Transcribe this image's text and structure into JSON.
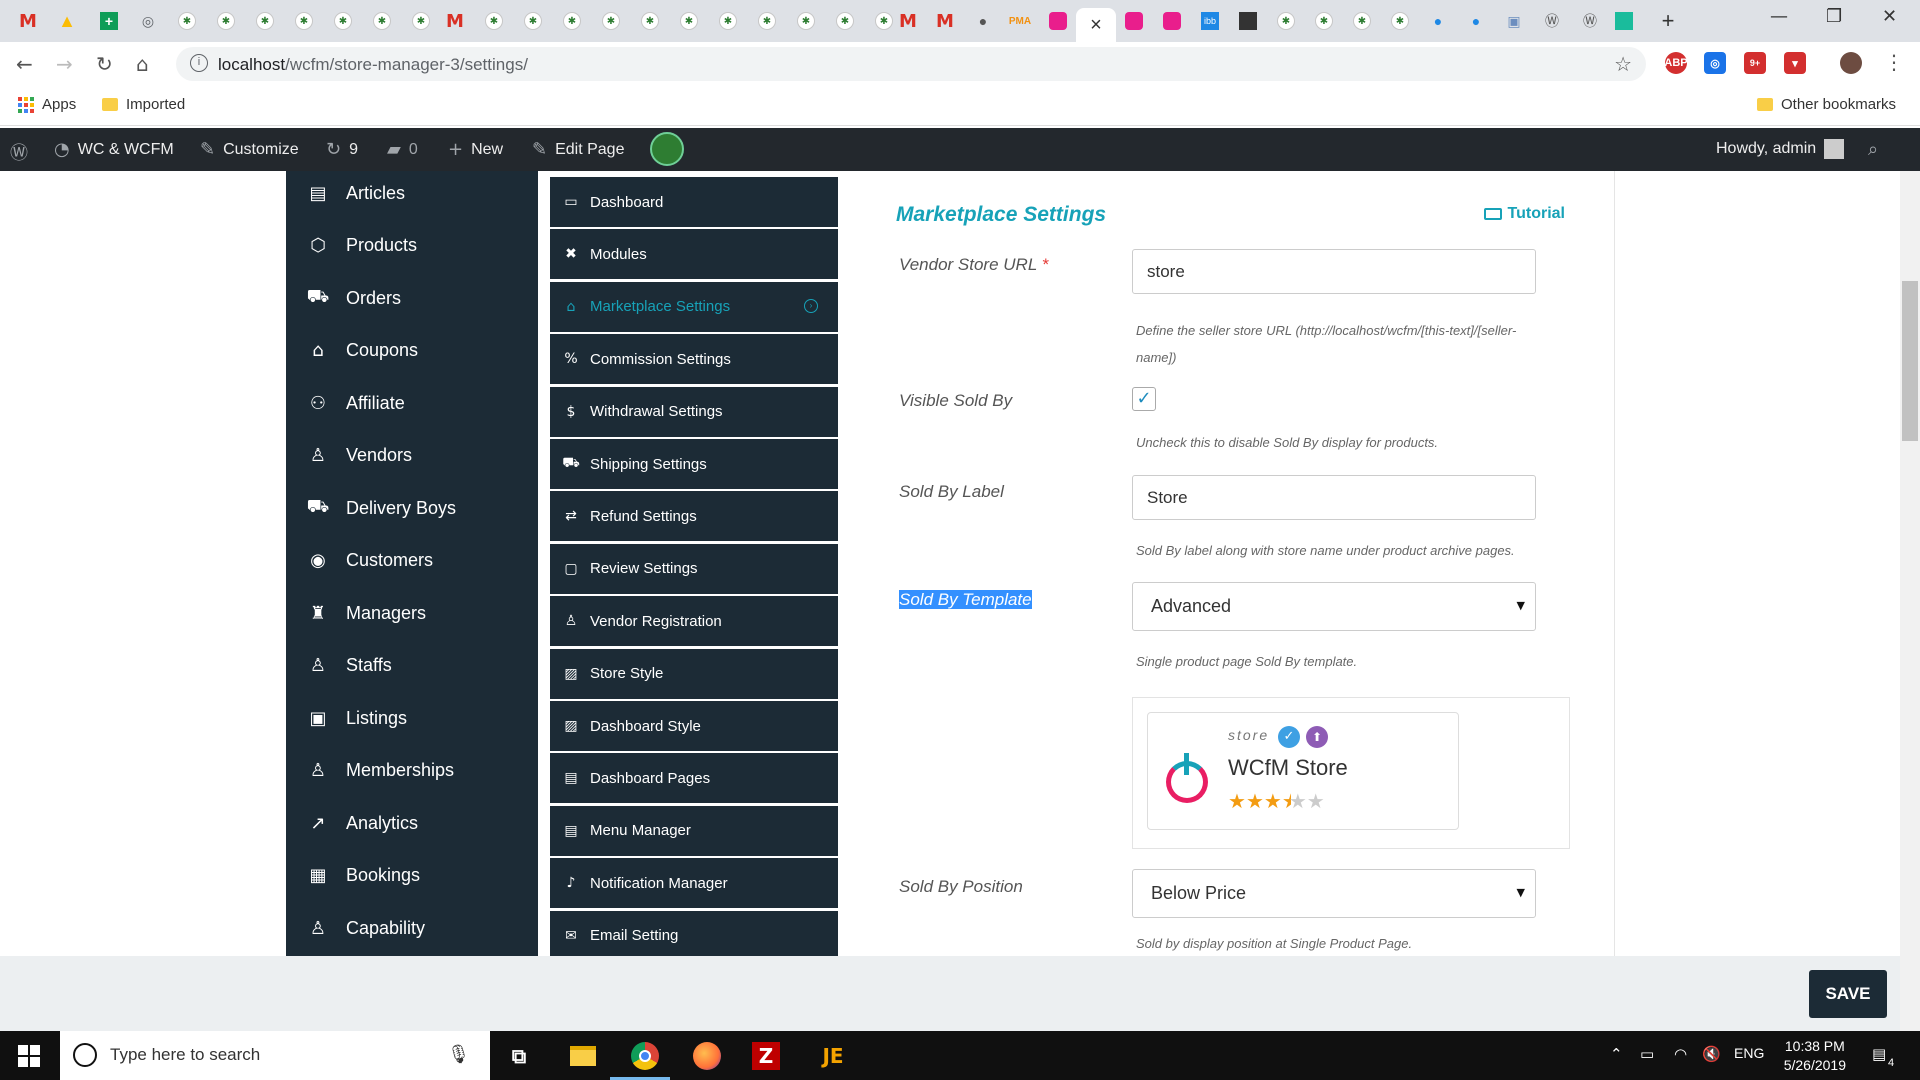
{
  "browser": {
    "active_tab_close": "×",
    "new_tab": "+",
    "window_controls": [
      "—",
      "❐",
      "✕"
    ],
    "url_host": "localhost",
    "url_path": "/wcfm/store-manager-3/settings/",
    "extensions": [
      {
        "name": "abp",
        "label": "ABP",
        "color": "#d32f2f"
      },
      {
        "name": "lens",
        "label": "◎",
        "color": "#1a73e8"
      },
      {
        "name": "notif",
        "label": "9+",
        "color": "#d32f2f"
      },
      {
        "name": "pocket",
        "label": "▾",
        "color": "#d32f2f"
      }
    ],
    "bookmarks": {
      "apps": "Apps",
      "imported": "Imported",
      "other": "Other bookmarks"
    }
  },
  "adminbar": {
    "site_name": "WC & WCFM",
    "customize": "Customize",
    "updates_count": "9",
    "comments_count": "0",
    "new_label": "New",
    "edit_page": "Edit Page",
    "greeting": "Howdy, admin"
  },
  "left_nav": {
    "items": [
      {
        "label": "Articles",
        "icon": "▤"
      },
      {
        "label": "Products",
        "icon": "⬡"
      },
      {
        "label": "Orders",
        "icon": "⛟"
      },
      {
        "label": "Coupons",
        "icon": "⌂"
      },
      {
        "label": "Affiliate",
        "icon": "⚇"
      },
      {
        "label": "Vendors",
        "icon": "♙"
      },
      {
        "label": "Delivery Boys",
        "icon": "⛟"
      },
      {
        "label": "Customers",
        "icon": "◉"
      },
      {
        "label": "Managers",
        "icon": "♜"
      },
      {
        "label": "Staffs",
        "icon": "♙"
      },
      {
        "label": "Listings",
        "icon": "▣"
      },
      {
        "label": "Memberships",
        "icon": "♙"
      },
      {
        "label": "Analytics",
        "icon": "↗"
      },
      {
        "label": "Bookings",
        "icon": "▦"
      },
      {
        "label": "Capability",
        "icon": "♙"
      }
    ]
  },
  "settings_nav": {
    "items": [
      {
        "label": "Dashboard",
        "icon": "▭"
      },
      {
        "label": "Modules",
        "icon": "✖"
      },
      {
        "label": "Marketplace Settings",
        "icon": "⌂"
      },
      {
        "label": "Commission Settings",
        "icon": "%"
      },
      {
        "label": "Withdrawal Settings",
        "icon": "$"
      },
      {
        "label": "Shipping Settings",
        "icon": "⛟"
      },
      {
        "label": "Refund Settings",
        "icon": "⇄"
      },
      {
        "label": "Review Settings",
        "icon": "▢"
      },
      {
        "label": "Vendor Registration",
        "icon": "♙"
      },
      {
        "label": "Store Style",
        "icon": "▨"
      },
      {
        "label": "Dashboard Style",
        "icon": "▨"
      },
      {
        "label": "Dashboard Pages",
        "icon": "▤"
      },
      {
        "label": "Menu Manager",
        "icon": "▤"
      },
      {
        "label": "Notification Manager",
        "icon": "♪"
      },
      {
        "label": "Email Setting",
        "icon": "✉"
      }
    ],
    "active_index": 2
  },
  "panel": {
    "title": "Marketplace Settings",
    "tutorial": "Tutorial",
    "vendor_store_url": {
      "label": "Vendor Store URL",
      "required": "*",
      "value": "store",
      "help": "Define the seller store URL (http://localhost/wcfm/[this-text]/[seller-name])"
    },
    "visible_sold_by": {
      "label": "Visible Sold By",
      "checked": true,
      "help": "Uncheck this to disable Sold By display for products."
    },
    "sold_by_label": {
      "label": "Sold By Label",
      "value": "Store",
      "help": "Sold By label along with store name under product archive pages."
    },
    "sold_by_template": {
      "label": "Sold By Template",
      "value": "Advanced",
      "help": "Single product page Sold By template."
    },
    "preview": {
      "store_caption": "store",
      "store_name": "WCfM Store",
      "rating": 3.5
    },
    "sold_by_position": {
      "label": "Sold By Position",
      "value": "Below Price",
      "help": "Sold by display position at Single Product Page."
    }
  },
  "save_button": "SAVE",
  "taskbar": {
    "search_placeholder": "Type here to search",
    "language": "ENG",
    "time": "10:38 PM",
    "date": "5/26/2019",
    "notifications": "4"
  }
}
